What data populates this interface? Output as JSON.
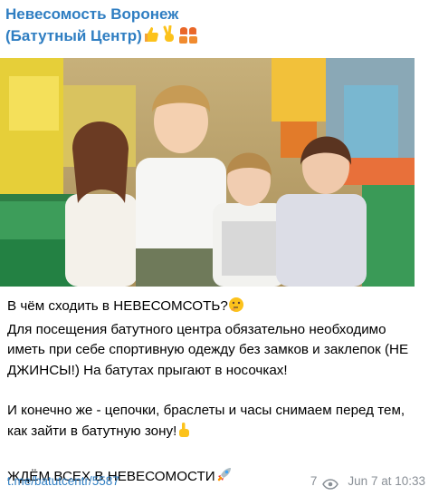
{
  "channel": {
    "title_line1": "Невесомость Воронеж",
    "title_line2": "(Батутный Центр)",
    "title_emoji": [
      "thumbs-up-icon",
      "victory-hand-icon",
      "two-women-icon"
    ]
  },
  "photo": {
    "description_icon": "group-photo-image"
  },
  "message": {
    "para1_line1": "В чём сходить в НЕВЕСОМСОТЬ?",
    "para1_line1_emoji": "thinking-face-icon",
    "para1_rest": "Для посещения батутного центра обязательно необходимо иметь при себе спортивную одежду без замков и заклепок (НЕ ДЖИНСЫ!) На батутах прыгают в носочках!",
    "para2": "И конечно же - цепочки, браслеты и часы снимаем перед тем, как зайти в батутную зону!",
    "para2_emoji": "index-pointing-up-icon",
    "para3": "ЖДЁМ ВСЕХ В НЕВЕСОМОСТИ",
    "para3_emoji": "rocket-icon"
  },
  "footer": {
    "link": "t.me/batutcentr/5587",
    "views": "7",
    "timestamp": "Jun 7 at 10:33"
  },
  "colors": {
    "accent": "#2f7ec2",
    "meta": "#8a9097"
  }
}
